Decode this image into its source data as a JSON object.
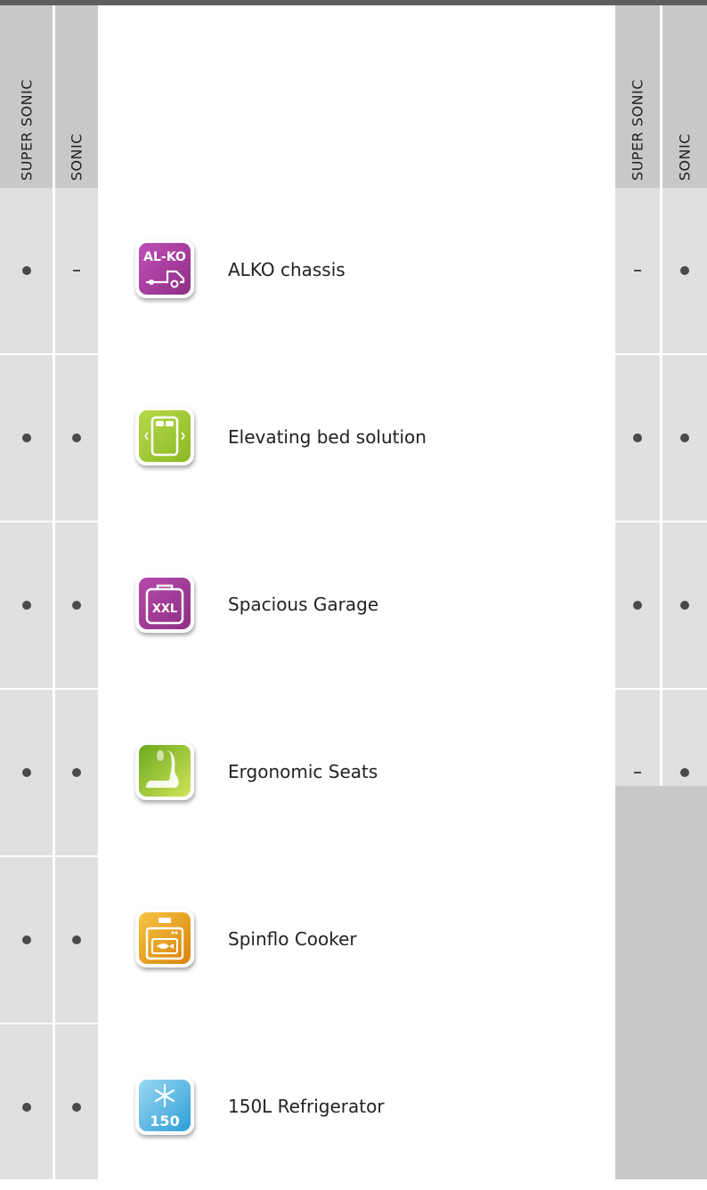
{
  "columns": {
    "left": [
      "SUPER SONIC",
      "SONIC"
    ],
    "right": [
      "SUPER SONIC",
      "SONIC"
    ]
  },
  "features": [
    {
      "label": "ALKO chassis",
      "icon": "alko-chassis-icon",
      "icon_text": "AL-KO",
      "left": [
        "dot",
        "dash"
      ],
      "right": [
        "dash",
        "dot"
      ]
    },
    {
      "label": "Elevating bed solution",
      "icon": "elevating-bed-icon",
      "icon_text": "",
      "left": [
        "dot",
        "dot"
      ],
      "right": [
        "dot",
        "dot"
      ]
    },
    {
      "label": "Spacious Garage",
      "icon": "xxl-garage-icon",
      "icon_text": "XXL",
      "left": [
        "dot",
        "dot"
      ],
      "right": [
        "dot",
        "dot"
      ]
    },
    {
      "label": "Ergonomic Seats",
      "icon": "seat-icon",
      "icon_text": "",
      "left": [
        "dot",
        "dot"
      ],
      "right": [
        "dash",
        "dot"
      ]
    },
    {
      "label": "Spinflo Cooker",
      "icon": "cooker-icon",
      "icon_text": "",
      "left": [
        "dot",
        "dot"
      ],
      "right": null
    },
    {
      "label": "150L Refrigerator",
      "icon": "refrigerator-icon",
      "icon_text": "150",
      "left": [
        "dot",
        "dot"
      ],
      "right": null
    }
  ],
  "colors": {
    "header_gray": "#c8c8c9",
    "column_gray": "#e0e0e0",
    "alko": "#8e2f86",
    "bed": "#8db824",
    "garage": "#8e2f86",
    "seat": "#9ec531",
    "cooker": "#e8a317",
    "fridge": "#2c9fd6"
  }
}
